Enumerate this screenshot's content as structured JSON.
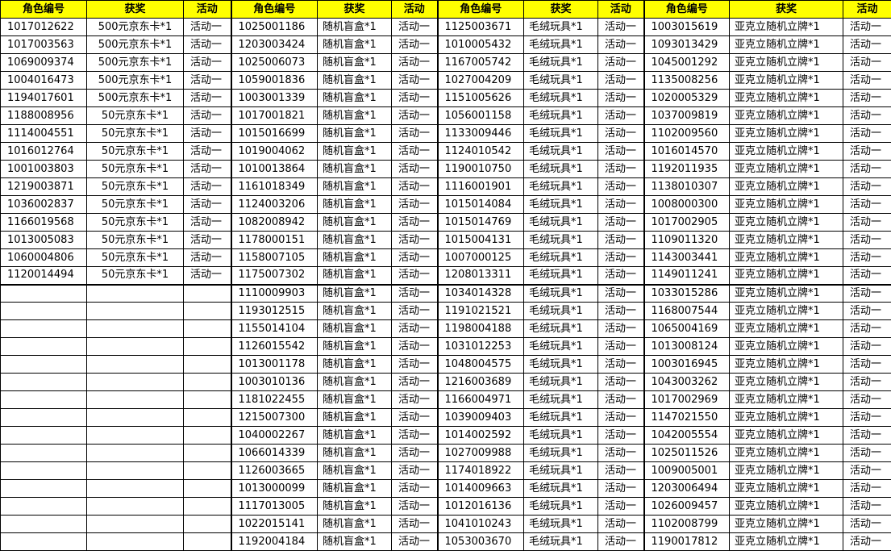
{
  "headers": {
    "id": "角色编号",
    "prize": "获奖",
    "activity": "活动"
  },
  "groups": [
    {
      "prize_label": "",
      "rows": [
        [
          "1017012622",
          "500元京东卡*1",
          "活动一"
        ],
        [
          "1017003563",
          "500元京东卡*1",
          "活动一"
        ],
        [
          "1069009374",
          "500元京东卡*1",
          "活动一"
        ],
        [
          "1004016473",
          "500元京东卡*1",
          "活动一"
        ],
        [
          "1194017601",
          "500元京东卡*1",
          "活动一"
        ],
        [
          "1188008956",
          "50元京东卡*1",
          "活动一"
        ],
        [
          "1114004551",
          "50元京东卡*1",
          "活动一"
        ],
        [
          "1016012764",
          "50元京东卡*1",
          "活动一"
        ],
        [
          "1001003803",
          "50元京东卡*1",
          "活动一"
        ],
        [
          "1219003871",
          "50元京东卡*1",
          "活动一"
        ],
        [
          "1036002837",
          "50元京东卡*1",
          "活动一"
        ],
        [
          "1166019568",
          "50元京东卡*1",
          "活动一"
        ],
        [
          "1013005083",
          "50元京东卡*1",
          "活动一"
        ],
        [
          "1060004806",
          "50元京东卡*1",
          "活动一"
        ],
        [
          "1120014494",
          "50元京东卡*1",
          "活动一"
        ]
      ]
    },
    {
      "prize_label": "随机盲盒*1",
      "activity_label": "活动一",
      "ids": [
        "1025001186",
        "1203003424",
        "1025006073",
        "1059001836",
        "1003001339",
        "1017001821",
        "1015016699",
        "1019004062",
        "1010013864",
        "1161018349",
        "1124003206",
        "1082008942",
        "1178000151",
        "1158007105",
        "1175007302",
        "1110009903",
        "1193012515",
        "1155014104",
        "1126015542",
        "1013001178",
        "1003010136",
        "1181022455",
        "1215007300",
        "1040002267",
        "1066014339",
        "1126003665",
        "1013000099",
        "1117013005",
        "1022015141",
        "1192004184"
      ]
    },
    {
      "prize_label": "毛绒玩具*1",
      "activity_label": "活动一",
      "ids": [
        "1125003671",
        "1010005432",
        "1167005742",
        "1027004209",
        "1151005626",
        "1056001158",
        "1133009446",
        "1124010542",
        "1190010750",
        "1116001901",
        "1015014084",
        "1015014769",
        "1015004131",
        "1007000125",
        "1208013311",
        "1034014328",
        "1191021521",
        "1198004188",
        "1031012253",
        "1048004575",
        "1216003689",
        "1166004971",
        "1039009403",
        "1014002592",
        "1027009988",
        "1174018922",
        "1014009663",
        "1012016136",
        "1041010243",
        "1053003670"
      ]
    },
    {
      "prize_label": "亚克立随机立牌*1",
      "activity_label": "活动一",
      "ids": [
        "1003015619",
        "1093013429",
        "1045001292",
        "1135008256",
        "1020005329",
        "1037009819",
        "1102009560",
        "1016014570",
        "1192011935",
        "1138010307",
        "1008000300",
        "1017002905",
        "1109011320",
        "1143003441",
        "1149011241",
        "1033015286",
        "1168007544",
        "1065004169",
        "1013008124",
        "1003016945",
        "1043003262",
        "1017002969",
        "1147021550",
        "1042005554",
        "1025011526",
        "1009005001",
        "1203006494",
        "1026009457",
        "1102008799",
        "1190017812"
      ]
    }
  ],
  "colors": {
    "header_bg": "#ffff00",
    "border": "#000000"
  }
}
